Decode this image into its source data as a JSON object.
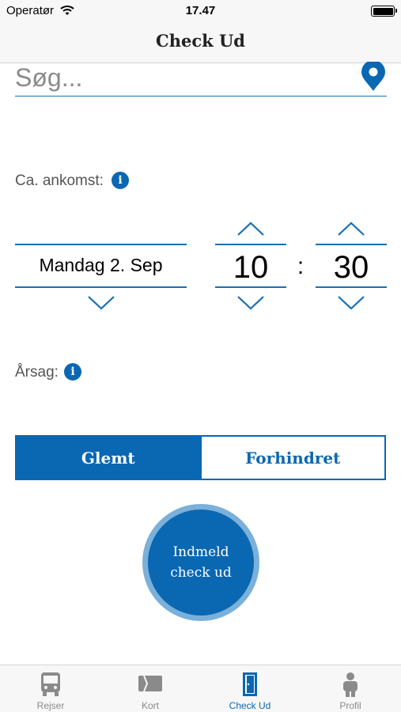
{
  "status_bar": {
    "carrier": "Operatør",
    "time": "17.47"
  },
  "nav": {
    "title": "Check Ud"
  },
  "search": {
    "placeholder": "Søg..."
  },
  "arrival": {
    "label": "Ca. ankomst:",
    "info_icon": "i",
    "date": "Mandag 2. Sep",
    "hour": "10",
    "separator": ":",
    "minute": "30"
  },
  "reason": {
    "label": "Årsag:",
    "info_icon": "i",
    "options": [
      {
        "label": "Glemt",
        "selected": true
      },
      {
        "label": "Forhindret",
        "selected": false
      }
    ]
  },
  "checkout_button": {
    "line1": "Indmeld",
    "line2": "check ud"
  },
  "tabs": [
    {
      "label": "Rejser",
      "icon": "bus-icon",
      "active": false
    },
    {
      "label": "Kort",
      "icon": "card-icon",
      "active": false
    },
    {
      "label": "Check Ud",
      "icon": "door-icon",
      "active": true
    },
    {
      "label": "Profil",
      "icon": "person-icon",
      "active": false
    }
  ],
  "colors": {
    "accent": "#0a67b2",
    "accent_light": "#7ab0d9",
    "inactive_tab": "#8a8a8a"
  }
}
